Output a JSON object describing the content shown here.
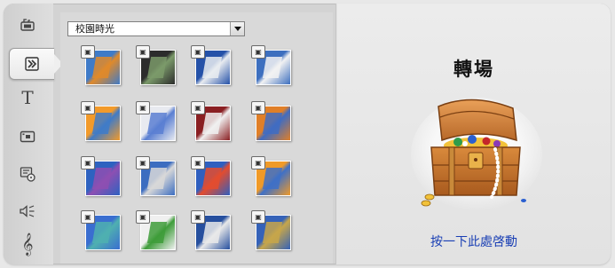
{
  "sidebar": {
    "items": [
      {
        "name": "video-tab",
        "icon": "film-camera-icon"
      },
      {
        "name": "transitions-tab",
        "icon": "transition-icon",
        "active": true
      },
      {
        "name": "titles-tab",
        "icon": "title-icon",
        "glyph": "T"
      },
      {
        "name": "photos-tab",
        "icon": "photo-icon"
      },
      {
        "name": "disc-menus-tab",
        "icon": "disc-menu-icon"
      },
      {
        "name": "sound-effects-tab",
        "icon": "speaker-icon"
      },
      {
        "name": "music-tab",
        "icon": "music-clef-icon",
        "glyph": "𝄞"
      }
    ]
  },
  "library": {
    "dropdown": {
      "selected": "校園時光"
    },
    "thumbnails": [
      {
        "colors": [
          "#3f7bc8",
          "#e08a2a"
        ]
      },
      {
        "colors": [
          "#2c2c2c",
          "#7b9a6a"
        ]
      },
      {
        "colors": [
          "#2451a8",
          "#e9ecf0"
        ]
      },
      {
        "colors": [
          "#3d6fbf",
          "#f2f2f2"
        ]
      },
      {
        "colors": [
          "#f29a2a",
          "#3f7bc8"
        ]
      },
      {
        "colors": [
          "#e8eaf0",
          "#5a7fd2"
        ]
      },
      {
        "colors": [
          "#8a1f22",
          "#f0f0f0"
        ]
      },
      {
        "colors": [
          "#e07f28",
          "#3f6cc2"
        ]
      },
      {
        "colors": [
          "#2e62c0",
          "#8e4fb2"
        ]
      },
      {
        "colors": [
          "#3c6dc0",
          "#d8d8d8"
        ]
      },
      {
        "colors": [
          "#2f5fbf",
          "#e44c2e"
        ]
      },
      {
        "colors": [
          "#f09a28",
          "#3e70c7"
        ]
      },
      {
        "colors": [
          "#3a6ed0",
          "#4fb0b0"
        ]
      },
      {
        "colors": [
          "#f0f0f0",
          "#3e9c3a"
        ]
      },
      {
        "colors": [
          "#264f9e",
          "#e9e9e9"
        ]
      },
      {
        "colors": [
          "#3562b8",
          "#c7a64a"
        ]
      }
    ]
  },
  "preview": {
    "title": "轉場",
    "action_link": "按一下此處啓動",
    "illustration": "treasure-chest-icon"
  }
}
